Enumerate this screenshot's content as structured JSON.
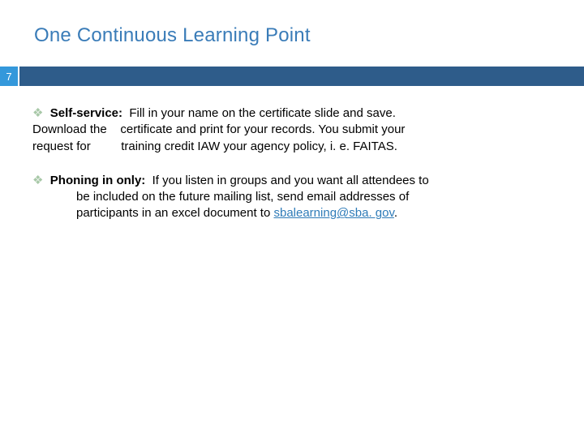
{
  "title": "One Continuous Learning Point",
  "page": "7",
  "bullet_glyph": "❖",
  "bullets": [
    {
      "heading": "Self-service:",
      "line1": "Fill in your name on the certificate slide and save.",
      "line2": "Download the    certificate and print for your records.  You submit your",
      "line3": "request for         training credit IAW your agency policy, i. e. FAITAS."
    },
    {
      "heading": "Phoning in only:",
      "line1": "If you listen in groups and you want all attendees to",
      "line2": "be included on the future mailing list, send email addresses of",
      "line3a": "participants in an excel document to ",
      "link": "sbalearning@sba. gov",
      "line3b": "."
    }
  ]
}
